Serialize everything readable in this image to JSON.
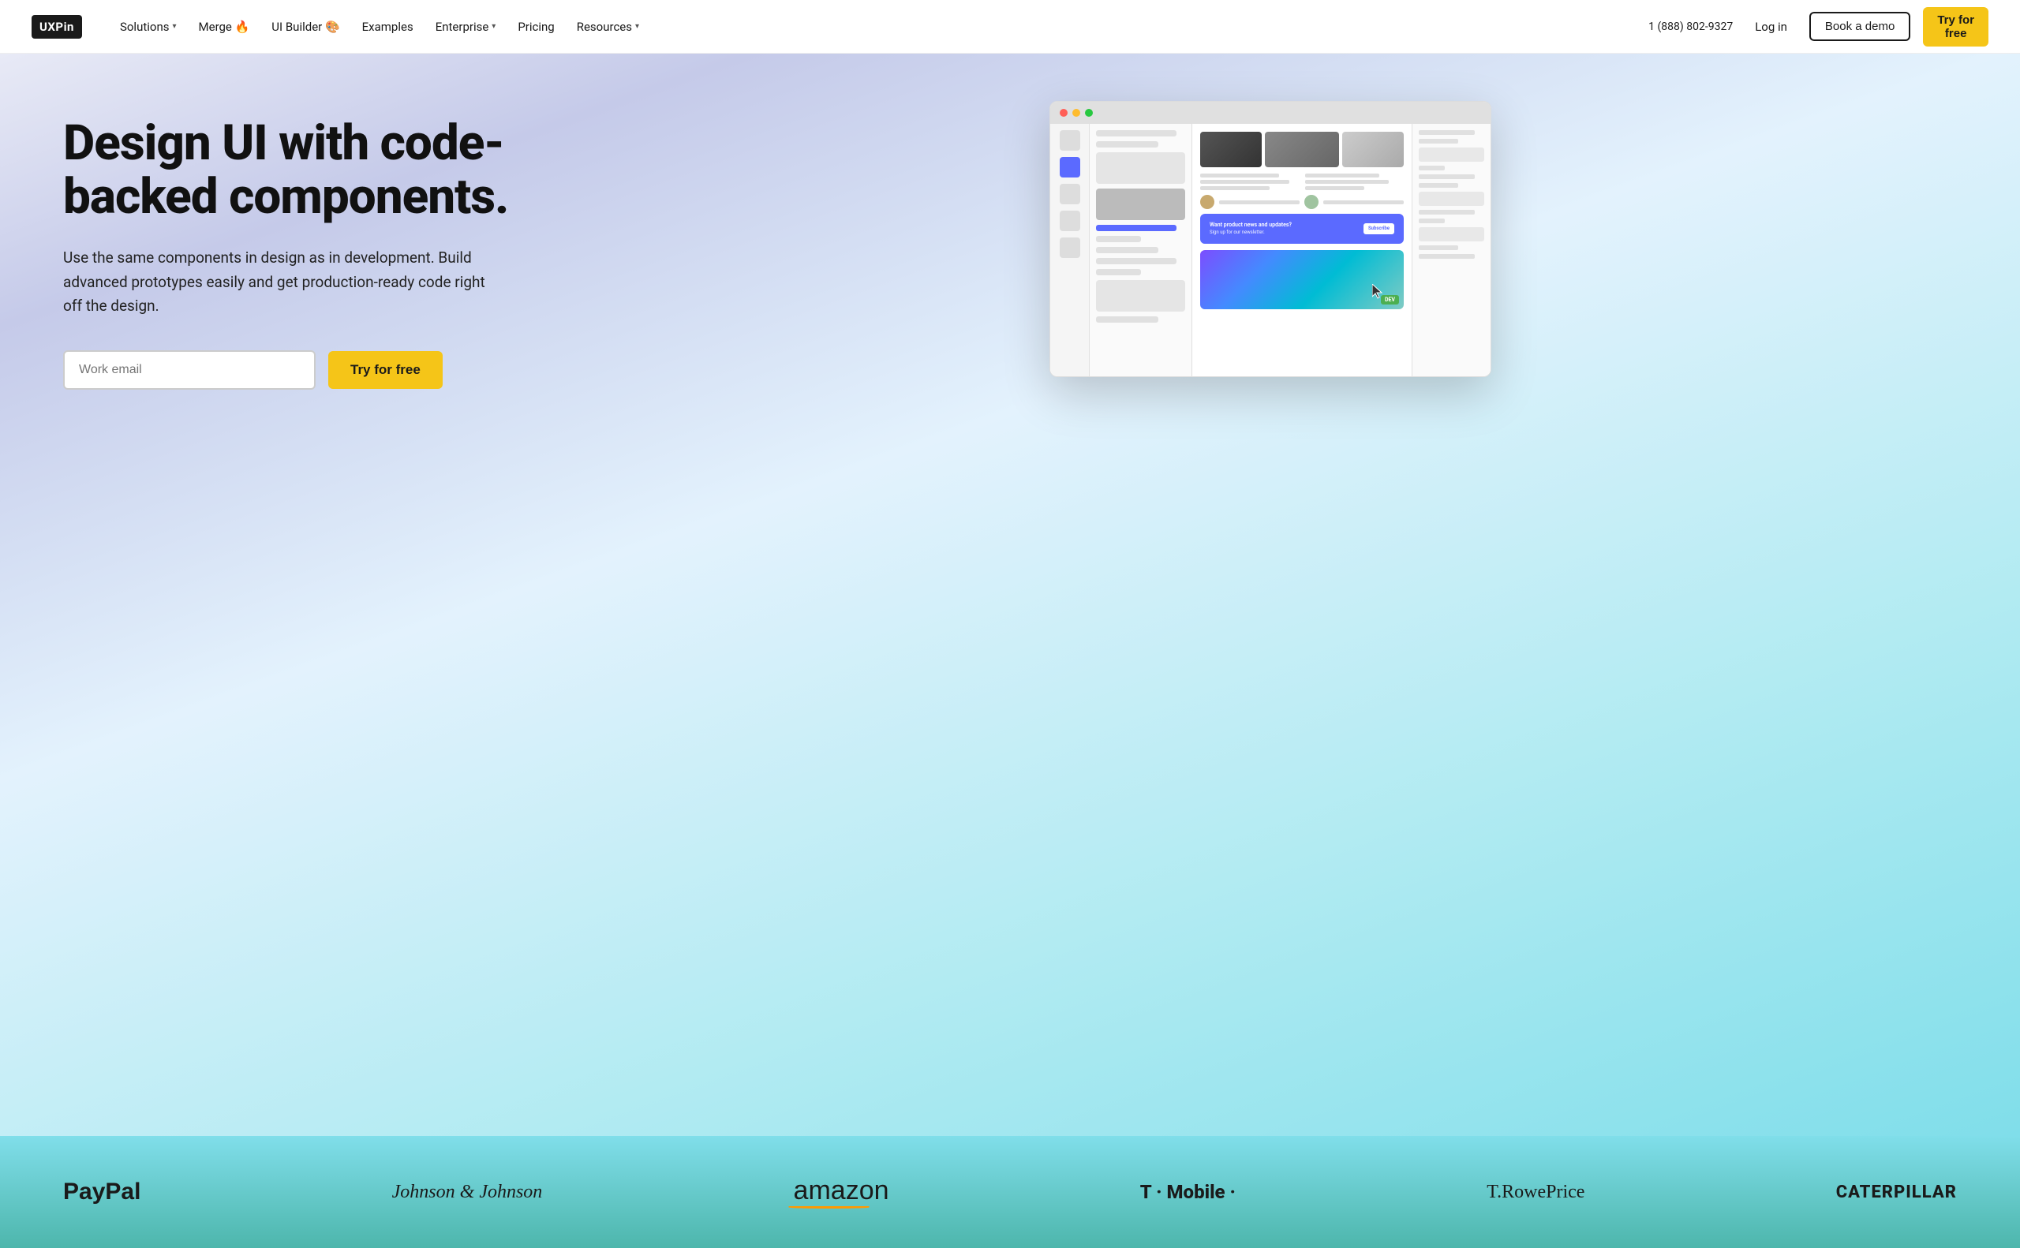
{
  "nav": {
    "logo": "UXPin",
    "links": [
      {
        "label": "Solutions",
        "hasDropdown": true
      },
      {
        "label": "Merge 🔥",
        "hasDropdown": false
      },
      {
        "label": "UI Builder 🎨",
        "hasDropdown": false
      },
      {
        "label": "Examples",
        "hasDropdown": false
      },
      {
        "label": "Enterprise",
        "hasDropdown": true
      },
      {
        "label": "Pricing",
        "hasDropdown": false
      },
      {
        "label": "Resources",
        "hasDropdown": true
      }
    ],
    "phone": "1 (888) 802-9327",
    "login": "Log in",
    "demo": "Book a demo",
    "try_free": "Try for free"
  },
  "hero": {
    "heading": "Design UI with code-backed components.",
    "subtext": "Use the same components in design as in development. Build advanced prototypes easily and get production-ready code right off the design.",
    "email_placeholder": "Work email",
    "cta_button": "Try for free"
  },
  "logos": [
    {
      "name": "PayPal",
      "class": "paypal"
    },
    {
      "name": "Johnson & Johnson",
      "class": "jj"
    },
    {
      "name": "amazon",
      "class": "amazon"
    },
    {
      "name": "T·Mobile·",
      "class": "tmobile"
    },
    {
      "name": "T.RowePrice",
      "class": "trowe"
    },
    {
      "name": "CATERPILLAR",
      "class": "caterpillar"
    }
  ]
}
